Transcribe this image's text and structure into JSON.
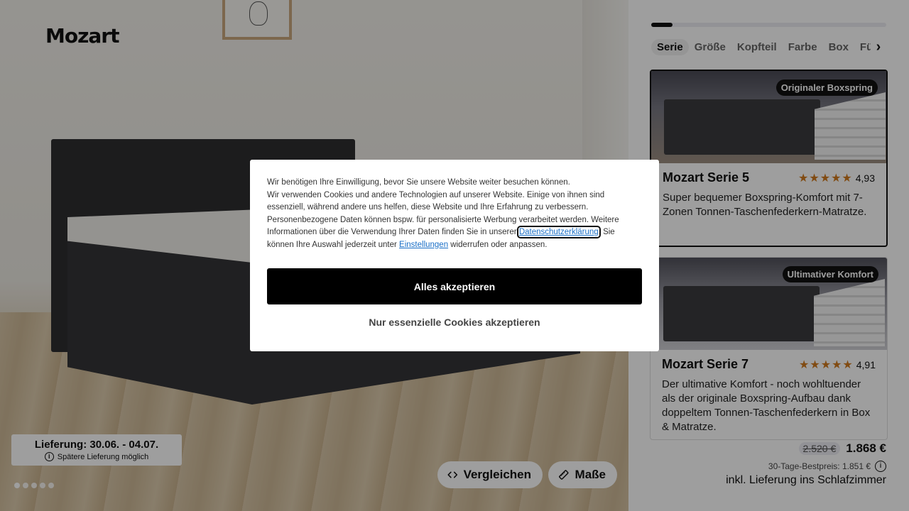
{
  "brand": {
    "logo": "Mozart"
  },
  "hero": {
    "delivery_title": "Lieferung: 30.06. - 04.07.",
    "delivery_note": "Spätere Lieferung möglich",
    "slides_total": 5,
    "slide_active": 1,
    "compare_label": "Vergleichen",
    "measure_label": "Maße"
  },
  "configurator": {
    "progress_fraction": 0.09,
    "tabs": [
      "Serie",
      "Größe",
      "Kopfteil",
      "Farbe",
      "Box",
      "Füß"
    ],
    "active_tab": "Serie",
    "cards": [
      {
        "badge": "Originaler Boxspring",
        "title": "Mozart Serie 5",
        "rating": "4,93",
        "stars": 5,
        "description": "Super bequemer Boxspring-Komfort mit 7-Zonen Tonnen-Taschenfederkern-Matratze.",
        "selected": true
      },
      {
        "badge": "Ultimativer Komfort",
        "title": "Mozart Serie 7",
        "rating": "4,91",
        "stars": 5,
        "description": "Der ultimative Komfort - noch wohltuender als der originale Boxspring-Aufbau dank doppeltem Tonnen-Taschenfederkern in Box & Matratze.",
        "selected": false
      }
    ],
    "old_price": "2.520 €",
    "new_price": "1.868 €",
    "best_price": "30-Tage-Bestpreis: 1.851 €",
    "shipping": "inkl. Lieferung ins Schlafzimmer"
  },
  "consent": {
    "intro": "Wir benötigen Ihre Einwilligung, bevor Sie unsere Website weiter besuchen können.",
    "body_before_link": "Wir verwenden Cookies und andere Technologien auf unserer Website. Einige von ihnen sind essenziell, während andere uns helfen, diese Website und Ihre Erfahrung zu verbessern. Personenbezogene Daten können bspw. für personalisierte Werbung verarbeitet werden. Weitere Informationen über die Verwendung Ihrer Daten finden Sie in unserer ",
    "privacy_link": "Datenschutzerklärung",
    "body_middle": ". Sie können Ihre Auswahl jederzeit unter ",
    "settings_link": "Einstellungen",
    "body_after_link": " widerrufen oder anpassen.",
    "accept_all": "Alles akzeptieren",
    "accept_essential": "Nur essenzielle Cookies akzeptieren"
  },
  "colors": {
    "accent": "#000000",
    "star": "#d07a1e",
    "link": "#1a6fc7"
  }
}
